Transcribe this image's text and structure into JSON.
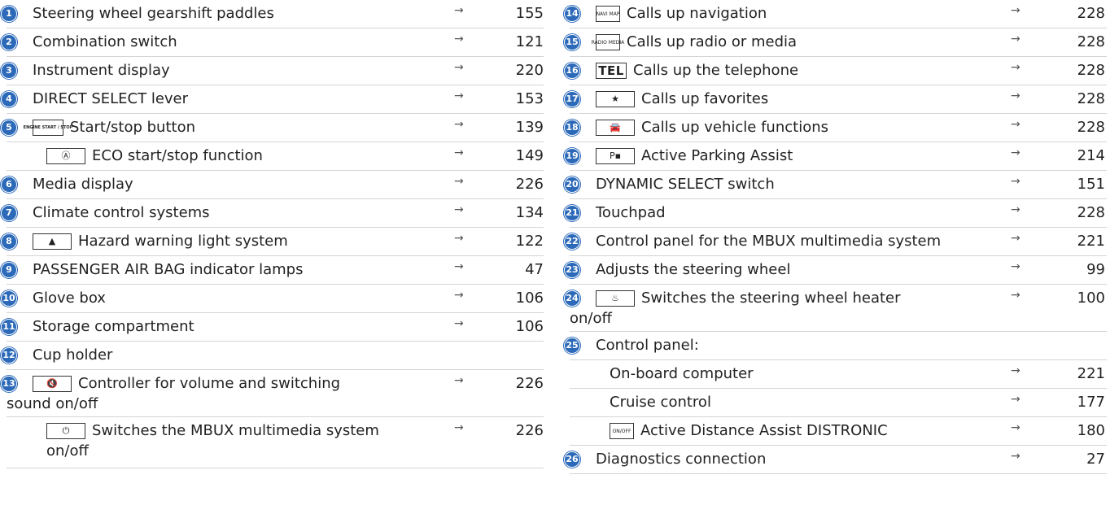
{
  "left": [
    {
      "num": "1",
      "label": "Steering wheel gearshift paddles",
      "page": "155",
      "arrow": "→"
    },
    {
      "num": "2",
      "label": "Combination switch",
      "page": "121",
      "arrow": "→"
    },
    {
      "num": "3",
      "label": "Instrument display",
      "page": "220",
      "arrow": "→"
    },
    {
      "num": "4",
      "label": "DIRECT SELECT lever",
      "page": "153",
      "arrow": "→"
    },
    {
      "num": "5",
      "icon": "engine-start-stop-icon",
      "icon_text": "ENGINE START / STOP",
      "label": "Start/stop button",
      "page": "139",
      "arrow": "→"
    },
    {
      "icon": "eco-start-stop-icon",
      "icon_text": "Ⓐ",
      "label": "ECO start/stop function",
      "page": "149",
      "arrow": "→"
    },
    {
      "num": "6",
      "label": "Media display",
      "page": "226",
      "arrow": "→"
    },
    {
      "num": "7",
      "label": "Climate control systems",
      "page": "134",
      "arrow": "→"
    },
    {
      "num": "8",
      "icon": "hazard-warning-icon",
      "icon_text": "▲",
      "label": "Hazard warning light system",
      "page": "122",
      "arrow": "→"
    },
    {
      "num": "9",
      "label": "PASSENGER AIR BAG indicator lamps",
      "page": "47",
      "arrow": "→"
    },
    {
      "num": "10",
      "label": "Glove box",
      "page": "106",
      "arrow": "→"
    },
    {
      "num": "11",
      "label": "Storage compartment",
      "page": "106",
      "arrow": "→"
    },
    {
      "num": "12",
      "label": "Cup holder",
      "page": "",
      "arrow": ""
    },
    {
      "num": "13",
      "icon": "mute-icon",
      "icon_text": "🔇",
      "label": "Controller for volume and switching",
      "label2": "sound on/off",
      "page": "226",
      "arrow": "→"
    },
    {
      "icon": "power-icon",
      "icon_text": "⏻",
      "label": "Switches the MBUX multimedia system",
      "label2": "on/off",
      "page": "226",
      "arrow": "→"
    }
  ],
  "right": [
    {
      "num": "14",
      "icon": "navi-map-icon",
      "icon_text": "NAVI MAP",
      "label": "Calls up navigation",
      "page": "228",
      "arrow": "→"
    },
    {
      "num": "15",
      "icon": "radio-media-icon",
      "icon_text": "RADIO MEDIA",
      "label": "Calls up radio or media",
      "page": "228",
      "arrow": "→"
    },
    {
      "num": "16",
      "icon": "tel-icon",
      "icon_text": "TEL",
      "label": "Calls up the telephone",
      "page": "228",
      "arrow": "→"
    },
    {
      "num": "17",
      "icon": "star-icon",
      "icon_text": "★",
      "label": "Calls up favorites",
      "page": "228",
      "arrow": "→"
    },
    {
      "num": "18",
      "icon": "car-icon",
      "icon_text": "🚘",
      "label": "Calls up vehicle functions",
      "page": "228",
      "arrow": "→"
    },
    {
      "num": "19",
      "icon": "parking-assist-icon",
      "icon_text": "P▪",
      "label": "Active Parking Assist",
      "page": "214",
      "arrow": "→"
    },
    {
      "num": "20",
      "label": "DYNAMIC SELECT switch",
      "page": "151",
      "arrow": "→"
    },
    {
      "num": "21",
      "label": "Touchpad",
      "page": "228",
      "arrow": "→"
    },
    {
      "num": "22",
      "label": "Control panel for the MBUX multimedia system",
      "page": "221",
      "arrow": "→"
    },
    {
      "num": "23",
      "label": "Adjusts the steering wheel",
      "page": "99",
      "arrow": "→"
    },
    {
      "num": "24",
      "icon": "steering-heater-icon",
      "icon_text": "♨",
      "label": "Switches the steering wheel heater",
      "label2": "on/off",
      "page": "100",
      "arrow": "→"
    },
    {
      "num": "25",
      "label": "Control panel:",
      "page": "",
      "arrow": ""
    },
    {
      "label": "On-board computer",
      "page": "221",
      "arrow": "→"
    },
    {
      "label": "Cruise control",
      "page": "177",
      "arrow": "→"
    },
    {
      "icon": "distronic-icon",
      "icon_text": "ON/OFF",
      "label": "Active Distance Assist DISTRONIC",
      "page": "180",
      "arrow": "→"
    },
    {
      "num": "26",
      "label": "Diagnostics connection",
      "page": "27",
      "arrow": "→"
    }
  ]
}
